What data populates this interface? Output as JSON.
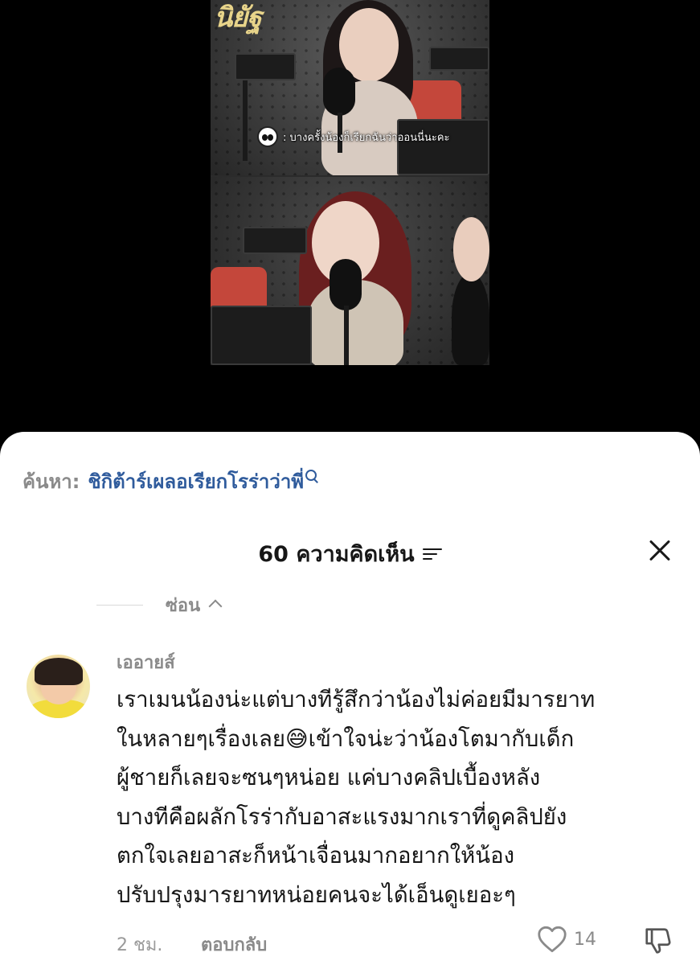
{
  "video": {
    "logo_text": "นิยัฐ",
    "caption": ": บางครั้งน้องก็เรียกฉันว่าออนนี่นะคะ"
  },
  "search": {
    "prefix": "ค้นหา:",
    "query": "ชิกิต้าร์เผลอเรียกโรร่าว่าพี่"
  },
  "comments_header": {
    "title": "60 ความคิดเห็น"
  },
  "hide_toggle": {
    "label": "ซ่อน"
  },
  "comment": {
    "username": "เออายส์",
    "text": "เราเมนน้องน่ะแต่บางทีรู้สึกว่าน้องไม่ค่อยมีมารยาท\nในหลายๆเรื่องเลย😅เข้าใจน่ะว่าน้องโตมากับเด็ก\nผู้ชายก็เลยจะซนๆหน่อย แค่บางคลิปเบื้องหลัง\nบางทีคือผลักโรร่ากับอาสะแรงมากเราที่ดูคลิปยัง\nตกใจเลยอาสะก็หน้าเจื่อนมากอยากให้น้อง\nปรับปรุงมารยาทหน่อยคนจะได้เอ็นดูเยอะๆ",
    "time": "2 ชม.",
    "reply_label": "ตอบกลับ",
    "like_count": "14"
  }
}
